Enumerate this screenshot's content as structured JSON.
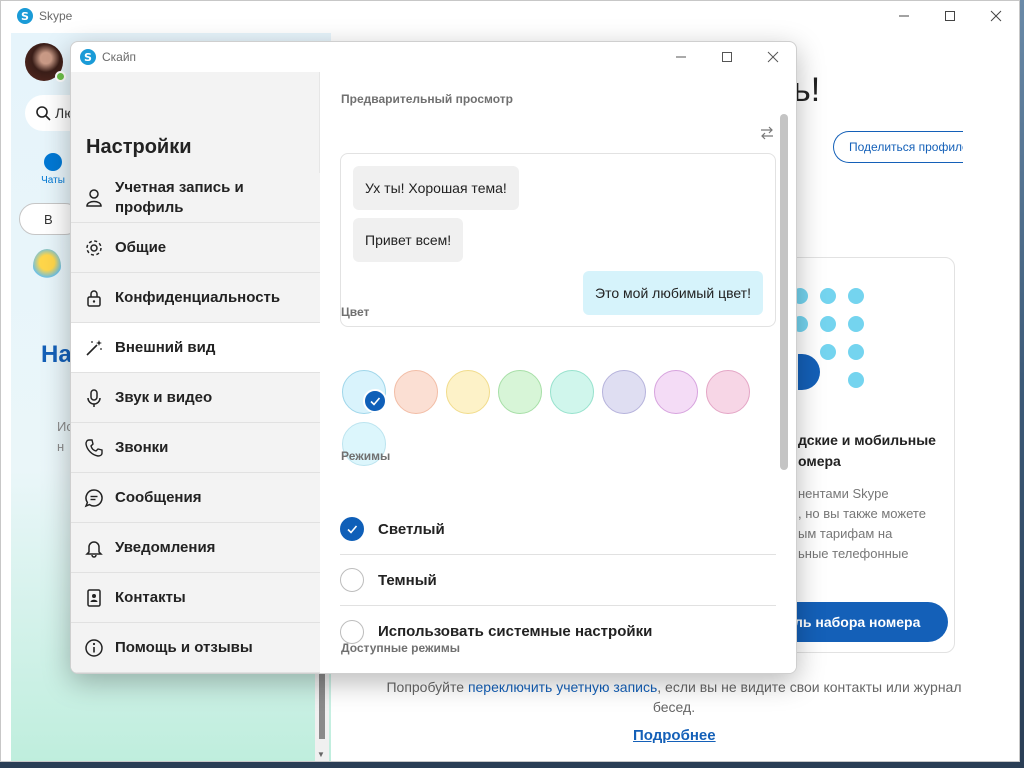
{
  "main": {
    "app_title": "Skype",
    "search_text": "Лю",
    "nav_chats_label": "Чаты",
    "meet_label": "В",
    "heading_fragment": "На",
    "info_fragment_1": "Ис",
    "info_fragment_2": "н",
    "greeting_fragment": "ь!",
    "share_profile_label": "Поделиться профилем",
    "card": {
      "title_line1": "дские и мобильные",
      "title_line2": "омера",
      "text_line1": "нентами Skype",
      "text_line2": ", но вы также можете",
      "text_line3": "ым тарифам на",
      "text_line4": "ьные телефонные",
      "button_label": "ль набора номера"
    },
    "footer": {
      "text_before": "Попробуйте",
      "link": "переключить учетную запись",
      "text_after": ", если вы не видите свои контакты или журнал бесед.",
      "more_link": "Подробнее"
    }
  },
  "dialog": {
    "title": "Скайп",
    "settings_heading": "Настройки",
    "nav": [
      {
        "id": "account",
        "icon": "person-icon",
        "label_line1": "Учетная запись и",
        "label_line2": "профиль",
        "active": false
      },
      {
        "id": "general",
        "icon": "gear-icon",
        "label_line1": "Общие",
        "label_line2": "",
        "active": false
      },
      {
        "id": "privacy",
        "icon": "lock-icon",
        "label_line1": "Конфиденциальность",
        "label_line2": "",
        "active": false
      },
      {
        "id": "appearance",
        "icon": "magic-wand-icon",
        "label_line1": "Внешний вид",
        "label_line2": "",
        "active": true
      },
      {
        "id": "audio-video",
        "icon": "microphone-icon",
        "label_line1": "Звук и видео",
        "label_line2": "",
        "active": false
      },
      {
        "id": "calls",
        "icon": "phone-icon",
        "label_line1": "Звонки",
        "label_line2": "",
        "active": false
      },
      {
        "id": "messages",
        "icon": "chat-bubble-icon",
        "label_line1": "Сообщения",
        "label_line2": "",
        "active": false
      },
      {
        "id": "notifications",
        "icon": "bell-icon",
        "label_line1": "Уведомления",
        "label_line2": "",
        "active": false
      },
      {
        "id": "contacts",
        "icon": "contacts-book-icon",
        "label_line1": "Контакты",
        "label_line2": "",
        "active": false
      },
      {
        "id": "help",
        "icon": "info-icon",
        "label_line1": "Помощь и отзывы",
        "label_line2": "",
        "active": false
      }
    ],
    "preview": {
      "label": "Предварительный просмотр",
      "msg1": "Ух ты! Хорошая тема!",
      "msg2": "Привет всем!",
      "msg3": "Это мой любимый цвет!"
    },
    "colors": {
      "label": "Цвет",
      "swatches": [
        {
          "fill": "#d9f3fc",
          "border": "#9fd6ea",
          "selected": true
        },
        {
          "fill": "#fbdfd3",
          "border": "#f2bda6",
          "selected": false
        },
        {
          "fill": "#fdf2c8",
          "border": "#f1dc8c",
          "selected": false
        },
        {
          "fill": "#d7f5d7",
          "border": "#a7dfa7",
          "selected": false
        },
        {
          "fill": "#d0f6ec",
          "border": "#97e2cd",
          "selected": false
        },
        {
          "fill": "#dfdef2",
          "border": "#b6b3dc",
          "selected": false
        },
        {
          "fill": "#f4dcf6",
          "border": "#d7a3de",
          "selected": false
        },
        {
          "fill": "#f7d6e6",
          "border": "#e4a6c6",
          "selected": false
        },
        {
          "fill": "#dcf6fc",
          "border": "#bce4ef",
          "selected": false
        }
      ]
    },
    "modes": {
      "label": "Режимы",
      "options": [
        {
          "label": "Светлый",
          "selected": true
        },
        {
          "label": "Темный",
          "selected": false
        },
        {
          "label": "Использовать системные настройки",
          "selected": false
        }
      ],
      "available_label": "Доступные режимы"
    }
  },
  "accent_color": "#0f5fb8"
}
